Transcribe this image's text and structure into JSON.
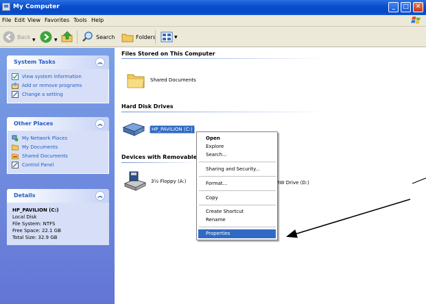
{
  "window": {
    "title": "My Computer"
  },
  "menu": [
    "File",
    "Edit",
    "View",
    "Favorites",
    "Tools",
    "Help"
  ],
  "toolbar": {
    "back": "Back",
    "search": "Search",
    "folders": "Folders"
  },
  "taskpane": {
    "system_tasks": {
      "title": "System Tasks",
      "items": [
        "View system information",
        "Add or remove programs",
        "Change a setting"
      ]
    },
    "other_places": {
      "title": "Other Places",
      "items": [
        "My Network Places",
        "My Documents",
        "Shared Documents",
        "Control Panel"
      ]
    },
    "details": {
      "title": "Details",
      "name": "HP_PAVILION (C:)",
      "type": "Local Disk",
      "file_system": "File System: NTFS",
      "free_space": "Free Space: 22.1 GB",
      "total_size": "Total Size: 32.9 GB"
    }
  },
  "content": {
    "groups": {
      "files": "Files Stored on This Computer",
      "hard_disks": "Hard Disk Drives",
      "removable": "Devices with Removable"
    },
    "items": {
      "shared_documents": "Shared Documents",
      "hp_pavilion": "HP_PAVILION (C:)",
      "floppy": "3½ Floppy (A:)",
      "cd_drive": "RW Drive (D:)"
    }
  },
  "context_menu": {
    "open": "Open",
    "explore": "Explore",
    "search": "Search...",
    "sharing": "Sharing and Security...",
    "format": "Format...",
    "copy": "Copy",
    "create_shortcut": "Create Shortcut",
    "rename": "Rename",
    "properties": "Properties"
  },
  "icons": {
    "back": "back-arrow-icon",
    "forward": "forward-arrow-icon",
    "up": "up-folder-icon",
    "search": "search-icon",
    "folders": "folders-icon",
    "views": "views-icon"
  },
  "colors": {
    "titlebar": "#0a4fcf",
    "taskpane": "#6f8fe0",
    "selection": "#316ac5",
    "link": "#215dc6"
  }
}
